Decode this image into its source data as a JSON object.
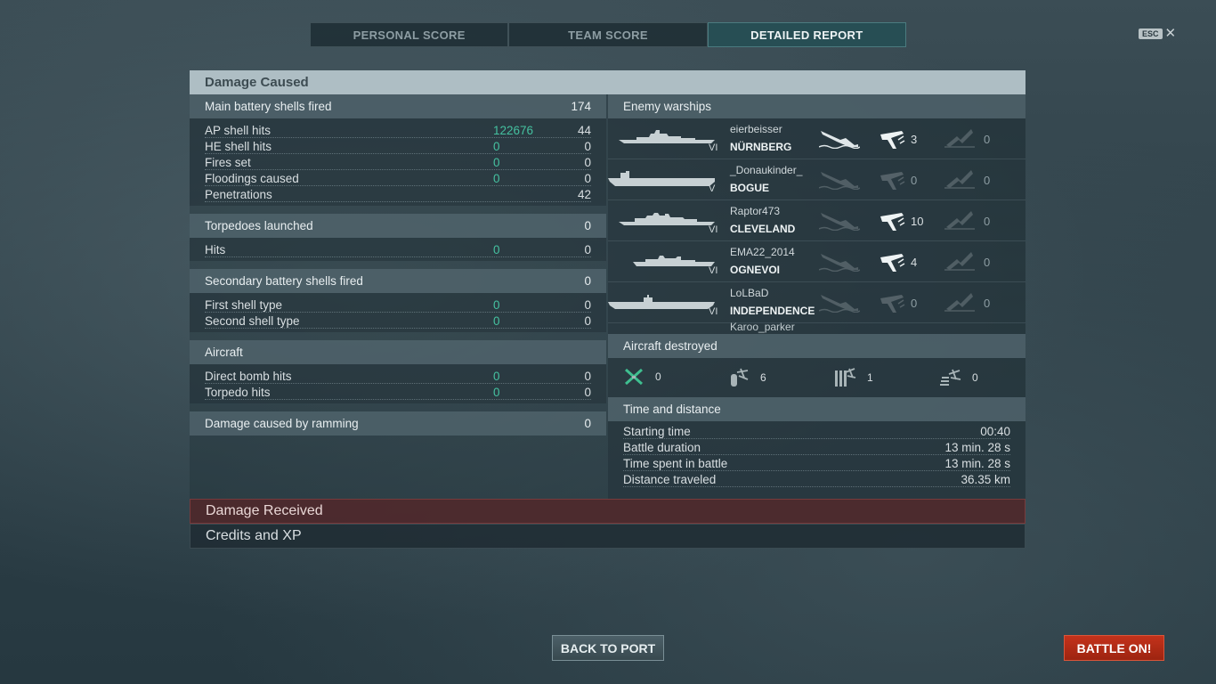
{
  "tabs": [
    {
      "label": "PERSONAL SCORE",
      "active": false
    },
    {
      "label": "TEAM SCORE",
      "active": false
    },
    {
      "label": "DETAILED REPORT",
      "active": true
    }
  ],
  "esc": {
    "key": "ESC",
    "close": "✕"
  },
  "damage_caused": {
    "title": "Damage Caused",
    "main_battery": {
      "label": "Main battery shells fired",
      "value": "174",
      "rows": [
        {
          "label": "AP shell hits",
          "damage": "122676",
          "value": "44"
        },
        {
          "label": "HE shell hits",
          "damage": "0",
          "value": "0"
        },
        {
          "label": "Fires set",
          "damage": "0",
          "value": "0"
        },
        {
          "label": "Floodings caused",
          "damage": "0",
          "value": "0"
        },
        {
          "label": "Penetrations",
          "damage": "",
          "value": "42"
        }
      ]
    },
    "torpedoes": {
      "label": "Torpedoes launched",
      "value": "0",
      "rows": [
        {
          "label": "Hits",
          "damage": "0",
          "value": "0"
        }
      ]
    },
    "secondary": {
      "label": "Secondary battery shells fired",
      "value": "0",
      "rows": [
        {
          "label": "First shell type",
          "damage": "0",
          "value": "0"
        },
        {
          "label": "Second shell type",
          "damage": "0",
          "value": "0"
        }
      ]
    },
    "aircraft": {
      "label": "Aircraft",
      "rows": [
        {
          "label": "Direct bomb hits",
          "damage": "0",
          "value": "0"
        },
        {
          "label": "Torpedo hits",
          "damage": "0",
          "value": "0"
        }
      ]
    },
    "ramming": {
      "label": "Damage caused by ramming",
      "value": "0"
    },
    "enemy_warships": {
      "label": "Enemy warships",
      "ships": [
        {
          "tier": "VI",
          "player": "eierbeisser",
          "ship": "NÜRNBERG",
          "sunk": true,
          "plane_kills": "3",
          "plane_active": true,
          "other": "0"
        },
        {
          "tier": "V",
          "player": "_Donaukinder_",
          "ship": "BOGUE",
          "sunk": false,
          "plane_kills": "0",
          "plane_active": false,
          "other": "0"
        },
        {
          "tier": "VI",
          "player": "Raptor473",
          "ship": "CLEVELAND",
          "sunk": false,
          "plane_kills": "10",
          "plane_active": true,
          "other": "0"
        },
        {
          "tier": "VI",
          "player": "EMA22_2014",
          "ship": "OGNEVOI",
          "sunk": false,
          "plane_kills": "4",
          "plane_active": true,
          "other": "0"
        },
        {
          "tier": "VI",
          "player": "LoLBaD",
          "ship": "INDEPENDENCE",
          "sunk": false,
          "plane_kills": "0",
          "plane_active": false,
          "other": "0"
        }
      ],
      "partial_player": "Karoo_parker"
    },
    "aircraft_destroyed": {
      "label": "Aircraft destroyed",
      "items": [
        {
          "icon": "fighter-icon",
          "value": "0"
        },
        {
          "icon": "torpedo-bomber-icon",
          "value": "6"
        },
        {
          "icon": "dive-bomber-icon",
          "value": "1"
        },
        {
          "icon": "spotter-plane-icon",
          "value": "0"
        }
      ]
    },
    "time_distance": {
      "label": "Time and distance",
      "rows": [
        {
          "label": "Starting time",
          "value": "00:40"
        },
        {
          "label": "Battle duration",
          "value": "13 min. 28 s"
        },
        {
          "label": "Time spent in battle",
          "value": "13 min. 28 s"
        },
        {
          "label": "Distance traveled",
          "value": "36.35 km"
        }
      ]
    }
  },
  "damage_received": {
    "title": "Damage Received"
  },
  "credits_xp": {
    "title": "Credits and XP"
  },
  "buttons": {
    "back_to_port": "BACK TO PORT",
    "battle_on": "BATTLE ON!"
  },
  "colors": {
    "damage_green": "#45c1a0",
    "accent_red": "#c4321b",
    "header_grey": "#aebec4"
  }
}
